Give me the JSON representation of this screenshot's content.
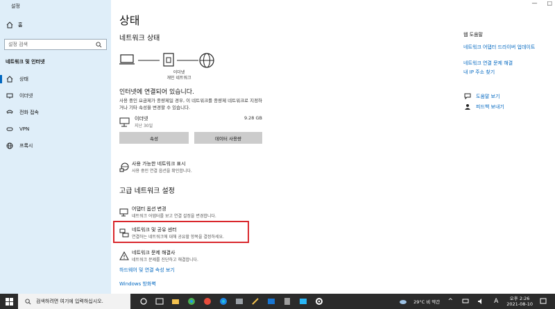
{
  "window": {
    "title": "설정",
    "minimize": "—",
    "maximize": "□"
  },
  "sidebar": {
    "back_glyph": "←",
    "home_label": "홈",
    "search_placeholder": "설정 검색",
    "section_title": "네트워크 및 인터넷",
    "items": [
      {
        "label": "상태",
        "icon": "home-icon",
        "active": true
      },
      {
        "label": "이더넷",
        "icon": "ethernet-icon",
        "active": false
      },
      {
        "label": "전화 접속",
        "icon": "dialup-icon",
        "active": false
      },
      {
        "label": "VPN",
        "icon": "vpn-icon",
        "active": false
      },
      {
        "label": "프록시",
        "icon": "globe-icon",
        "active": false
      }
    ]
  },
  "main": {
    "title": "상태",
    "network_status_title": "네트워크 상태",
    "diagram_caption": [
      "이더넷",
      "개인 네트워크"
    ],
    "connected_text": "인터넷에 연결되어 있습니다.",
    "connected_desc": "사용 중인 요금제가 종량제일 경우, 이 네트워크를 종량제 네트워크로 지정하거나 기타 속성을 변경할 수 있습니다.",
    "connection": {
      "name": "이더넷",
      "period": "지난 30일",
      "usage": "9.28 GB"
    },
    "buttons": {
      "properties": "속성",
      "data_usage": "데이터 사용량"
    },
    "show_available": {
      "title": "사용 가능한 네트워크 표시",
      "desc": "사용 중인 연결 옵션을 확인합니다."
    },
    "advanced_title": "고급 네트워크 설정",
    "adapter": {
      "title": "어댑터 옵션 변경",
      "desc": "네트워크 어댑터를 보고 연결 설정을 변경합니다."
    },
    "sharing_center": {
      "title": "네트워크 및 공유 센터",
      "desc": "연결하는 네트워크에 대해 공유할 항목을 결정하세요."
    },
    "troubleshooter": {
      "title": "네트워크 문제 해결사",
      "desc": "네트워크 문제를 진단하고 해결합니다."
    },
    "hardware_link": "하드웨어 및 연결 속성 보기",
    "firewall_link": "Windows 방화벽"
  },
  "help": {
    "title": "웹 도움말",
    "links": [
      "네트워크 어댑터 드라이버 업데이트",
      "네트워크 연결 문제 해결",
      "내 IP 주소 찾기"
    ],
    "get_help": "도움말 보기",
    "feedback": "피드백 보내기"
  },
  "taskbar": {
    "search_placeholder": "검색하려면 여기에 입력하십시오.",
    "weather": "29°C 비 약간",
    "time": "오후 2:26",
    "date": "2021-08-10"
  },
  "colors": {
    "accent": "#0067c0",
    "highlight": "#d9262b",
    "sidebar_bg": "#dfeef9",
    "taskbar_bg": "#2b2b2b"
  }
}
